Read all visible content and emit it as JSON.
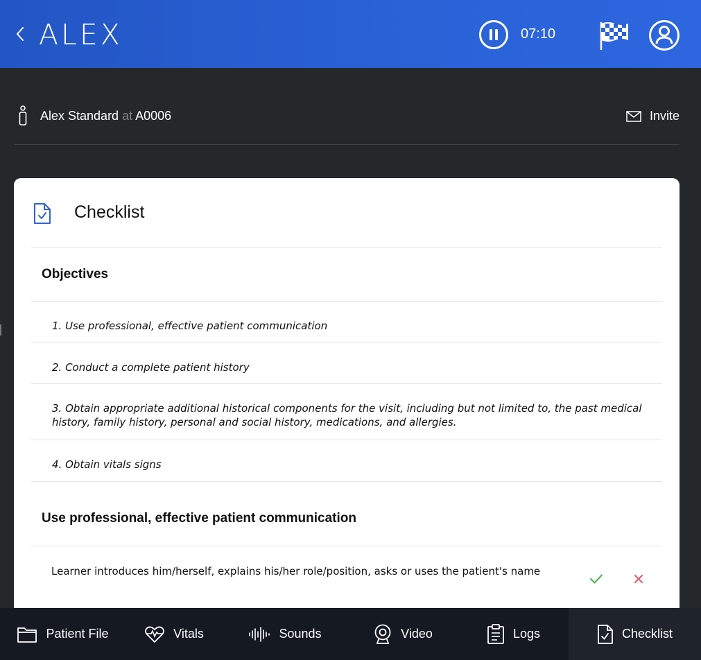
{
  "header": {
    "brand": "ALEX",
    "timer": "07:10"
  },
  "session": {
    "name": "Alex Standard",
    "at": "at",
    "code": "A0006",
    "invite_label": "Invite"
  },
  "checklist": {
    "title": "Checklist",
    "objectives_heading": "Objectives",
    "objectives": [
      "1. Use professional, effective patient communication",
      "2. Conduct a complete patient history",
      "3. Obtain appropriate additional historical components for the visit, including but not limited to, the past medical history, family history, personal and social history, medications, and allergies.",
      "4. Obtain vitals signs"
    ],
    "section_heading": "Use professional, effective patient communication",
    "criteria": [
      {
        "text": "Learner introduces him/herself, explains his/her role/position, asks or uses the patient's name"
      }
    ]
  },
  "nav": {
    "tabs": [
      {
        "label": "Patient File",
        "icon": "folder-icon"
      },
      {
        "label": "Vitals",
        "icon": "heart-pulse-icon"
      },
      {
        "label": "Sounds",
        "icon": "sound-wave-icon"
      },
      {
        "label": "Video",
        "icon": "webcam-icon"
      },
      {
        "label": "Logs",
        "icon": "clipboard-icon"
      },
      {
        "label": "Checklist",
        "icon": "checklist-icon"
      }
    ],
    "active": "Checklist"
  },
  "colors": {
    "header_blue": "#2a62d8",
    "background": "#25282b",
    "nav_bg": "#141922",
    "check_green": "#4caf50",
    "cross_red": "#e05a6a",
    "accent_blue": "#2f63d0"
  }
}
